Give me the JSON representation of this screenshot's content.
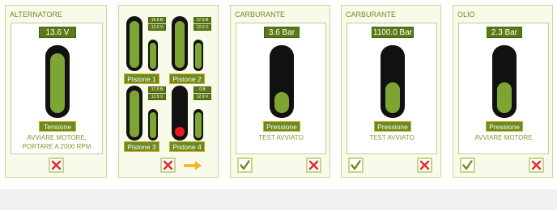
{
  "panels": {
    "alternatore": {
      "title": "ALTERNATORE",
      "value": "13.6 V",
      "label": "Tensione",
      "message_line1": "AVVIARE MOTORE,",
      "message_line2": "PORTARE A 2000 RPM",
      "level": 0.85
    },
    "pistoni": {
      "items": [
        {
          "label": "Pistone 1",
          "v1": "15.6 B",
          "v2": "12.0 V"
        },
        {
          "label": "Pistone 2",
          "v1": "17.5 B",
          "v2": "12.0 V"
        },
        {
          "label": "Pistone 3",
          "v1": "17.5 B",
          "v2": "12.9 V"
        },
        {
          "label": "Pistone 4",
          "v1": "0 B",
          "v2": "12.9 V"
        }
      ]
    },
    "carburante1": {
      "title": "CARBURANTE",
      "value": "3.6 Bar",
      "label": "Pressione",
      "message": "TEST AVVIATO",
      "level": 0.3
    },
    "carburante2": {
      "title": "CARBURANTE",
      "value": "1100.0 Bar",
      "label": "Pressione",
      "message": "TEST AVVIATO",
      "level": 0.45
    },
    "olio": {
      "title": "OLIO",
      "value": "2.3 Bar",
      "label": "Pressione",
      "message": "AVVIARE MOTORE",
      "level": 0.45
    }
  },
  "colors": {
    "accent_green": "#7ea534",
    "dark_green": "#5a7a16",
    "cancel_red": "#e0322c",
    "arrow_orange": "#f1b320",
    "warning_dot": "#e81c1c"
  }
}
